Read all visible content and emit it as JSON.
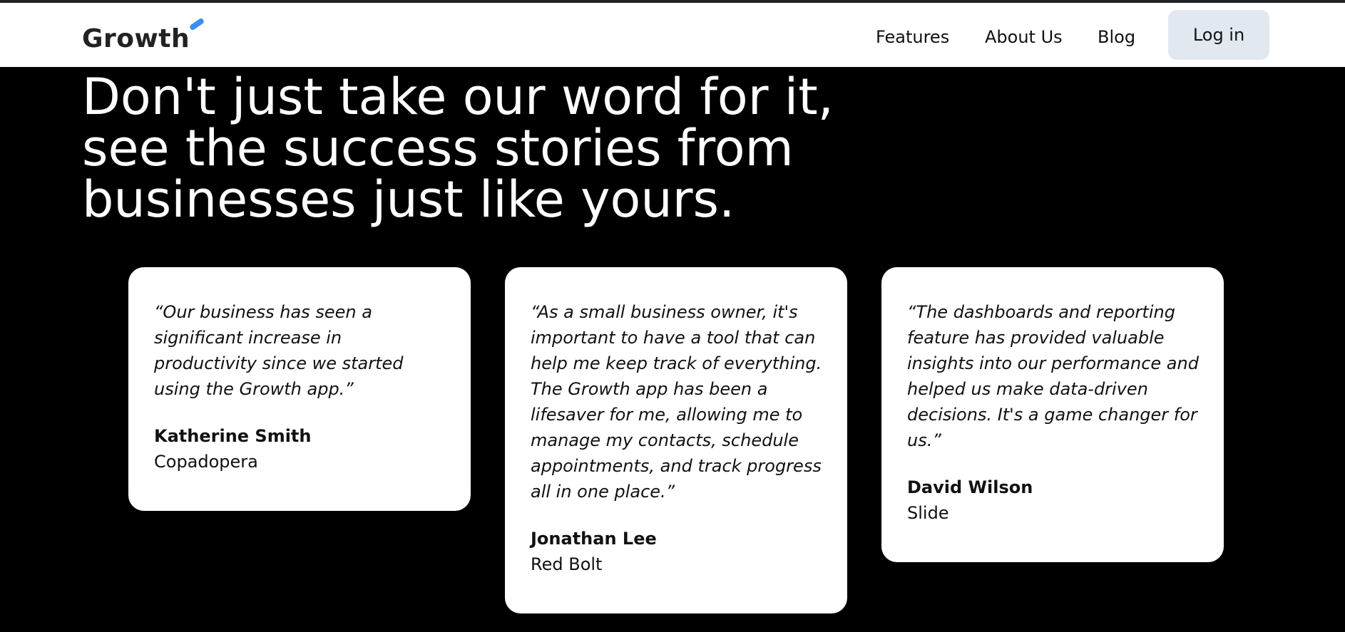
{
  "brand": {
    "name": "Growth",
    "accent_color": "#3a8ef6"
  },
  "nav": {
    "items": [
      {
        "label": "Features"
      },
      {
        "label": "About Us"
      },
      {
        "label": "Blog"
      }
    ],
    "login_label": "Log in"
  },
  "hero": {
    "line1": "Don't just take our word for it,",
    "line2": "see the success stories from",
    "line3": "businesses just like yours."
  },
  "testimonials": [
    {
      "quote": "“Our business has seen a significant increase in productivity since we started using the Growth app.”",
      "author": "Katherine Smith",
      "company": "Copadopera"
    },
    {
      "quote": "“As a small business owner, it's important to have a tool that can help me keep track of everything. The Growth app has been a lifesaver for me, allowing me to manage my contacts, schedule appointments, and track progress all in one place.”",
      "author": "Jonathan Lee",
      "company": "Red Bolt"
    },
    {
      "quote": "“The dashboards and reporting feature has provided valuable insights into our performance and helped us make data-driven decisions. It's a game changer for us.”",
      "author": "David Wilson",
      "company": "Slide"
    }
  ]
}
